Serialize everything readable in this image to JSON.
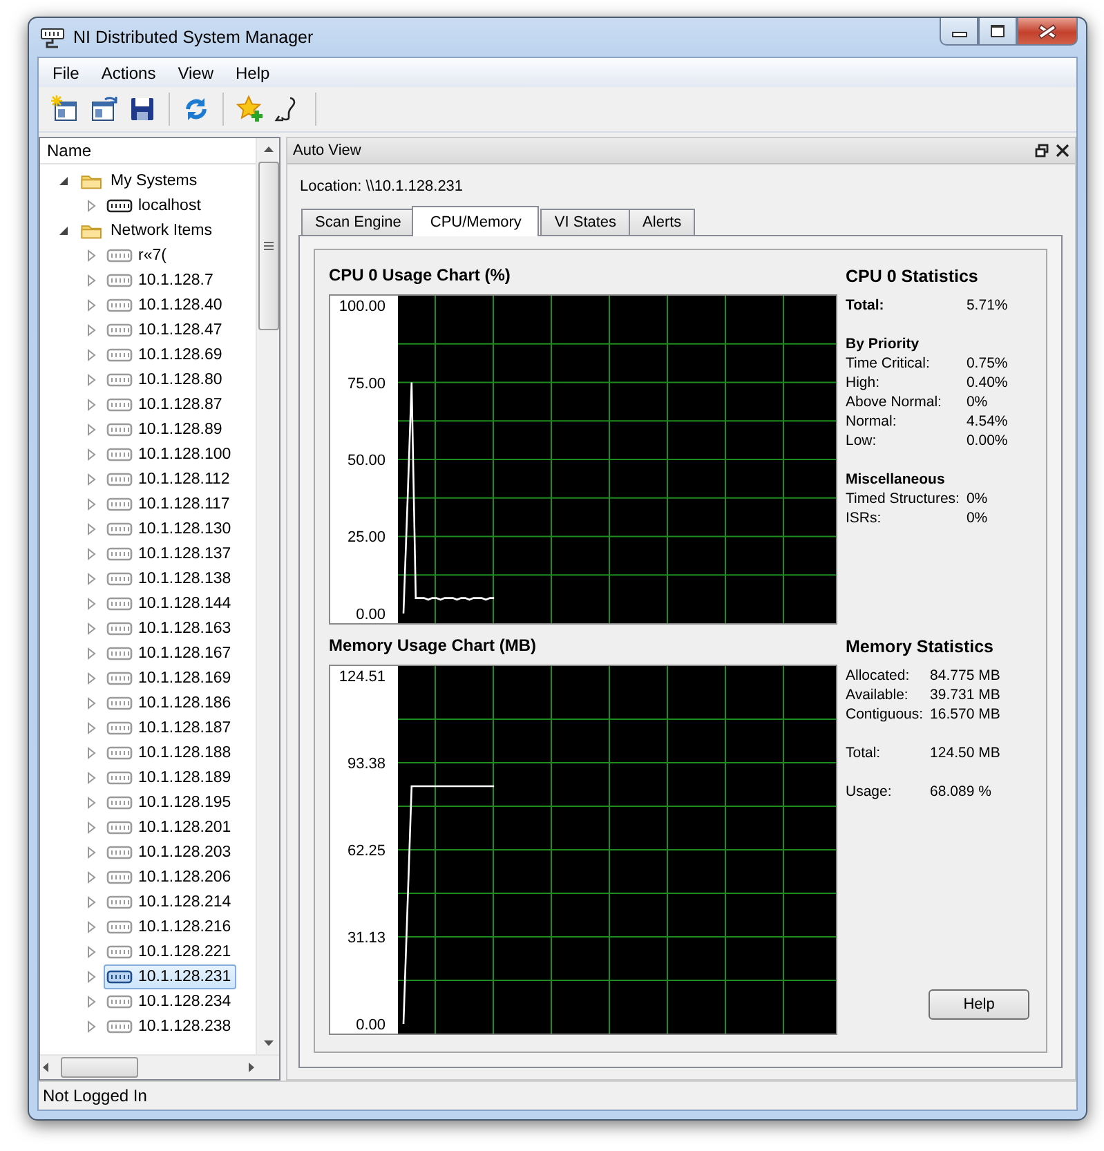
{
  "window": {
    "title": "NI Distributed System Manager"
  },
  "menu": [
    "File",
    "Actions",
    "View",
    "Help"
  ],
  "tree": {
    "header": "Name",
    "items": [
      {
        "label": "My Systems",
        "kind": "folder",
        "expanded": true,
        "selected": false,
        "children": [
          {
            "label": "localhost",
            "kind": "system",
            "expanded": false,
            "selected": false
          }
        ]
      },
      {
        "label": "Network Items",
        "kind": "folder",
        "expanded": true,
        "selected": false,
        "children": [
          {
            "label": "r«7(",
            "kind": "remote",
            "expanded": false,
            "selected": false
          },
          {
            "label": "10.1.128.7",
            "kind": "remote",
            "expanded": false,
            "selected": false
          },
          {
            "label": "10.1.128.40",
            "kind": "remote",
            "expanded": false,
            "selected": false
          },
          {
            "label": "10.1.128.47",
            "kind": "remote",
            "expanded": false,
            "selected": false
          },
          {
            "label": "10.1.128.69",
            "kind": "remote",
            "expanded": false,
            "selected": false
          },
          {
            "label": "10.1.128.80",
            "kind": "remote",
            "expanded": false,
            "selected": false
          },
          {
            "label": "10.1.128.87",
            "kind": "remote",
            "expanded": false,
            "selected": false
          },
          {
            "label": "10.1.128.89",
            "kind": "remote",
            "expanded": false,
            "selected": false
          },
          {
            "label": "10.1.128.100",
            "kind": "remote",
            "expanded": false,
            "selected": false
          },
          {
            "label": "10.1.128.112",
            "kind": "remote",
            "expanded": false,
            "selected": false
          },
          {
            "label": "10.1.128.117",
            "kind": "remote",
            "expanded": false,
            "selected": false
          },
          {
            "label": "10.1.128.130",
            "kind": "remote",
            "expanded": false,
            "selected": false
          },
          {
            "label": "10.1.128.137",
            "kind": "remote",
            "expanded": false,
            "selected": false
          },
          {
            "label": "10.1.128.138",
            "kind": "remote",
            "expanded": false,
            "selected": false
          },
          {
            "label": "10.1.128.144",
            "kind": "remote",
            "expanded": false,
            "selected": false
          },
          {
            "label": "10.1.128.163",
            "kind": "remote",
            "expanded": false,
            "selected": false
          },
          {
            "label": "10.1.128.167",
            "kind": "remote",
            "expanded": false,
            "selected": false
          },
          {
            "label": "10.1.128.169",
            "kind": "remote",
            "expanded": false,
            "selected": false
          },
          {
            "label": "10.1.128.186",
            "kind": "remote",
            "expanded": false,
            "selected": false
          },
          {
            "label": "10.1.128.187",
            "kind": "remote",
            "expanded": false,
            "selected": false
          },
          {
            "label": "10.1.128.188",
            "kind": "remote",
            "expanded": false,
            "selected": false
          },
          {
            "label": "10.1.128.189",
            "kind": "remote",
            "expanded": false,
            "selected": false
          },
          {
            "label": "10.1.128.195",
            "kind": "remote",
            "expanded": false,
            "selected": false
          },
          {
            "label": "10.1.128.201",
            "kind": "remote",
            "expanded": false,
            "selected": false
          },
          {
            "label": "10.1.128.203",
            "kind": "remote",
            "expanded": false,
            "selected": false
          },
          {
            "label": "10.1.128.206",
            "kind": "remote",
            "expanded": false,
            "selected": false
          },
          {
            "label": "10.1.128.214",
            "kind": "remote",
            "expanded": false,
            "selected": false
          },
          {
            "label": "10.1.128.216",
            "kind": "remote",
            "expanded": false,
            "selected": false
          },
          {
            "label": "10.1.128.221",
            "kind": "remote",
            "expanded": false,
            "selected": false
          },
          {
            "label": "10.1.128.231",
            "kind": "remote",
            "expanded": false,
            "selected": true
          },
          {
            "label": "10.1.128.234",
            "kind": "remote",
            "expanded": false,
            "selected": false
          },
          {
            "label": "10.1.128.238",
            "kind": "remote",
            "expanded": false,
            "selected": false
          }
        ]
      }
    ]
  },
  "panel": {
    "title": "Auto View",
    "location": "Location: \\\\10.1.128.231",
    "tabs": [
      {
        "label": "Scan Engine",
        "selected": false
      },
      {
        "label": "CPU/Memory",
        "selected": true
      },
      {
        "label": "VI States",
        "selected": false
      },
      {
        "label": "Alerts",
        "selected": false
      }
    ],
    "cpu": {
      "chart_data": {
        "type": "line",
        "title": "CPU 0 Usage Chart (%)",
        "categories": [
          null,
          null,
          null,
          null,
          null,
          null,
          null,
          null,
          null,
          null,
          null,
          null,
          null,
          null,
          null,
          null,
          null,
          null,
          null,
          null,
          null,
          null,
          null,
          null,
          null,
          null,
          null,
          null,
          null,
          null,
          null,
          null,
          null,
          null,
          null,
          null,
          null,
          null,
          null,
          null,
          null,
          null,
          null,
          null,
          null,
          null,
          null,
          null,
          null,
          null,
          null,
          null,
          null,
          null,
          null,
          null,
          null,
          null,
          null,
          null,
          null,
          null,
          null,
          null,
          null,
          null,
          null,
          null,
          null,
          null,
          null,
          null,
          null,
          null,
          null,
          null,
          null,
          null,
          null,
          null,
          null,
          null,
          null,
          null,
          null,
          null,
          null,
          null,
          null,
          null,
          null,
          null,
          null,
          null,
          null,
          null,
          null,
          null,
          null,
          null,
          null,
          null,
          null,
          null,
          null,
          null
        ],
        "ylim": [
          -3.14,
          103.14
        ],
        "grid": true,
        "yticks": [
          {
            "value": 0,
            "label": "0.00"
          },
          {
            "value": 25,
            "label": "25.00"
          },
          {
            "value": 50,
            "label": "50.00"
          },
          {
            "value": 75,
            "label": "75.00"
          },
          {
            "value": 100,
            "label": "100.00"
          }
        ],
        "series": [
          {
            "color": "#ffffff",
            "values": [
              null,
              0,
              37,
              75,
              5,
              5,
              5,
              4.5,
              5,
              5,
              4.5,
              5,
              5,
              5,
              4.5,
              5,
              5,
              4.5,
              5,
              5,
              5,
              4.5,
              5,
              5,
              null,
              null,
              null,
              null,
              null,
              null,
              null,
              null,
              null,
              null,
              null,
              null,
              null,
              null,
              null,
              null,
              null,
              null,
              null,
              null,
              null,
              null,
              null,
              null,
              null,
              null,
              null,
              null,
              null,
              null,
              null,
              null,
              null,
              null,
              null,
              null,
              null,
              null,
              null,
              null,
              null,
              null,
              null,
              null,
              null,
              null,
              null,
              null,
              null,
              null,
              null,
              null,
              null,
              null,
              null,
              null,
              null,
              null,
              null,
              null,
              null,
              null,
              null,
              null,
              null,
              null,
              null,
              null,
              null,
              null,
              null,
              null,
              null,
              null,
              null,
              null,
              null,
              null,
              null,
              null,
              null,
              null
            ]
          }
        ]
      },
      "stats_title": "CPU 0 Statistics",
      "groups": [
        {
          "kind": "total",
          "rows": [
            {
              "label": "Total:",
              "value": "5.71%"
            }
          ]
        },
        {
          "kind": "section",
          "heading": "By Priority",
          "rows": [
            {
              "label": "Time Critical:",
              "value": "0.75%"
            },
            {
              "label": "High:",
              "value": "0.40%"
            },
            {
              "label": "Above Normal:",
              "value": "0%"
            },
            {
              "label": "Normal:",
              "value": "4.54%"
            },
            {
              "label": "Low:",
              "value": "0.00%"
            }
          ]
        },
        {
          "kind": "section",
          "heading": "Miscellaneous",
          "rows": [
            {
              "label": "Timed Structures:",
              "value": "0%"
            },
            {
              "label": "ISRs:",
              "value": "0%"
            }
          ]
        }
      ]
    },
    "memory": {
      "chart_data": {
        "type": "line",
        "title": "Memory Usage Chart (MB)",
        "categories": [
          null,
          null,
          null,
          null,
          null,
          null,
          null,
          null,
          null,
          null,
          null,
          null,
          null,
          null,
          null,
          null,
          null,
          null,
          null,
          null,
          null,
          null,
          null,
          null,
          null,
          null,
          null,
          null,
          null,
          null,
          null,
          null,
          null,
          null,
          null,
          null,
          null,
          null,
          null,
          null,
          null,
          null,
          null,
          null,
          null,
          null,
          null,
          null,
          null,
          null,
          null,
          null,
          null,
          null,
          null,
          null,
          null,
          null,
          null,
          null,
          null,
          null,
          null,
          null,
          null,
          null,
          null,
          null,
          null,
          null,
          null,
          null,
          null,
          null,
          null,
          null,
          null,
          null,
          null,
          null,
          null,
          null,
          null,
          null,
          null,
          null,
          null,
          null,
          null,
          null,
          null,
          null,
          null,
          null,
          null,
          null,
          null,
          null,
          null,
          null,
          null,
          null,
          null,
          null,
          null,
          null
        ],
        "ylim": [
          -3.46,
          128
        ],
        "grid": true,
        "yticks": [
          {
            "value": 0,
            "label": "0.00"
          },
          {
            "value": 31.13,
            "label": "31.13"
          },
          {
            "value": 62.25,
            "label": "62.25"
          },
          {
            "value": 93.38,
            "label": "93.38"
          },
          {
            "value": 124.51,
            "label": "124.51"
          }
        ],
        "series": [
          {
            "color": "#ffffff",
            "values": [
              null,
              0,
              43,
              85,
              85,
              85,
              85,
              85,
              85,
              85,
              85,
              85,
              85,
              85,
              85,
              85,
              85,
              85,
              85,
              85,
              85,
              85,
              85,
              85,
              null,
              null,
              null,
              null,
              null,
              null,
              null,
              null,
              null,
              null,
              null,
              null,
              null,
              null,
              null,
              null,
              null,
              null,
              null,
              null,
              null,
              null,
              null,
              null,
              null,
              null,
              null,
              null,
              null,
              null,
              null,
              null,
              null,
              null,
              null,
              null,
              null,
              null,
              null,
              null,
              null,
              null,
              null,
              null,
              null,
              null,
              null,
              null,
              null,
              null,
              null,
              null,
              null,
              null,
              null,
              null,
              null,
              null,
              null,
              null,
              null,
              null,
              null,
              null,
              null,
              null,
              null,
              null,
              null,
              null,
              null,
              null,
              null,
              null,
              null,
              null,
              null,
              null,
              null,
              null,
              null,
              null
            ]
          }
        ]
      },
      "stats_title": "Memory Statistics",
      "groups": [
        {
          "rows": [
            {
              "label": "Allocated:",
              "value": "84.775 MB"
            },
            {
              "label": "Available:",
              "value": "39.731 MB"
            },
            {
              "label": "Contiguous:",
              "value": "16.570 MB"
            }
          ]
        },
        {
          "rows": [
            {
              "label": "Total:",
              "value": "124.50 MB"
            }
          ]
        },
        {
          "rows": [
            {
              "label": "Usage:",
              "value": "68.089 %"
            }
          ]
        }
      ]
    },
    "help_button": "Help"
  },
  "status_bar": "Not Logged In"
}
